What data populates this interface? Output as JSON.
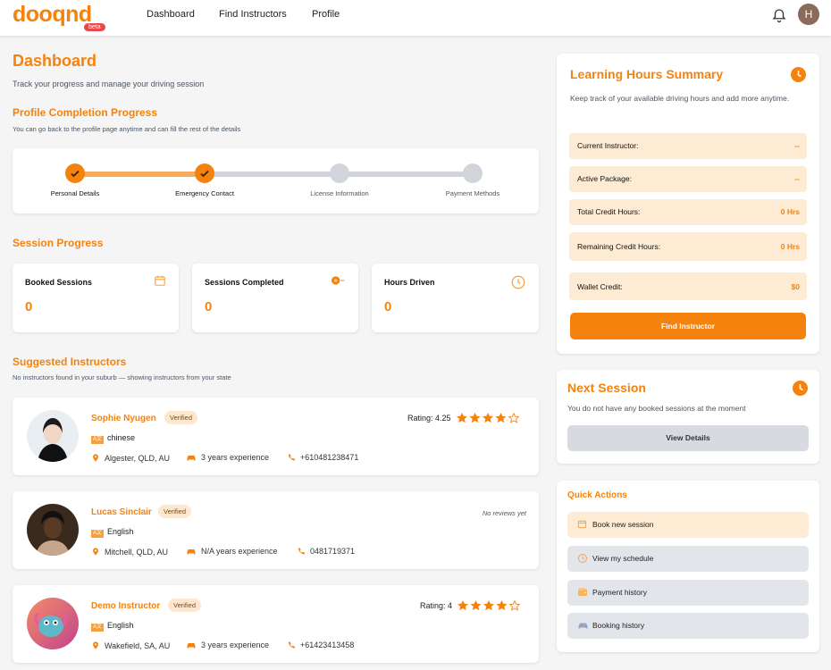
{
  "nav": {
    "logo": "dooqnd",
    "beta": "beta",
    "links": [
      "Dashboard",
      "Find Instructors",
      "Profile"
    ],
    "avatar_letter": "H"
  },
  "dashboard": {
    "title": "Dashboard",
    "subtitle": "Track your progress and manage your driving session"
  },
  "profile_progress": {
    "title": "Profile Completion Progress",
    "subtitle": "You can go back to the profile page anytime and can fill the rest of the details",
    "steps": [
      {
        "label": "Personal Details",
        "done": true
      },
      {
        "label": "Emergency Contact",
        "done": true
      },
      {
        "label": "License Information",
        "done": false
      },
      {
        "label": "Payment Methods",
        "done": false
      }
    ]
  },
  "session_progress": {
    "title": "Session Progress",
    "stats": [
      {
        "label": "Booked Sessions",
        "value": "0",
        "icon": "calendar-icon"
      },
      {
        "label": "Sessions Completed",
        "value": "0",
        "icon": "steering-wheel-icon"
      },
      {
        "label": "Hours Driven",
        "value": "0",
        "icon": "clock-icon"
      }
    ]
  },
  "suggested": {
    "title": "Suggested Instructors",
    "subtitle": "No instructors found in your suburb — showing instructors from your state",
    "instructors": [
      {
        "name": "Sophie Nyugen",
        "badge": "Verified",
        "language": "chinese",
        "location": "Algester, QLD, AU",
        "experience": "3 years experience",
        "phone": "+610481238471",
        "rating_label": "Rating: 4.25",
        "stars": 4
      },
      {
        "name": "Lucas Sinclair",
        "badge": "Verified",
        "language": "English",
        "location": "Mitchell, QLD, AU",
        "experience": "N/A years experience",
        "phone": "0481719371",
        "no_reviews": "No reviews yet"
      },
      {
        "name": "Demo Instructor",
        "badge": "Verified",
        "language": "English",
        "location": "Wakefield, SA, AU",
        "experience": "3 years experience",
        "phone": "+61423413458",
        "rating_label": "Rating: 4",
        "stars": 4
      }
    ]
  },
  "learning_hours": {
    "title": "Learning Hours Summary",
    "description": "Keep track of your available driving hours and add more anytime.",
    "rows": [
      {
        "label": "Current Instructor:",
        "value": "--"
      },
      {
        "label": "Active Package:",
        "value": "--"
      },
      {
        "label": "Total Credit Hours:",
        "value": "0 Hrs"
      },
      {
        "label": "Remaining Credit Hours:",
        "value": "0 Hrs"
      },
      {
        "label": "Wallet Credit:",
        "value": "$0"
      }
    ],
    "button": "Find Instructor"
  },
  "next_session": {
    "title": "Next Session",
    "text": "You do not have any booked sessions at the moment",
    "button": "View Details"
  },
  "quick_actions": {
    "title": "Quick Actions",
    "items": [
      {
        "label": "Book new session",
        "icon": "calendar-icon"
      },
      {
        "label": "View my schedule",
        "icon": "clock-icon"
      },
      {
        "label": "Payment history",
        "icon": "wallet-icon"
      },
      {
        "label": "Booking history",
        "icon": "car-icon"
      }
    ]
  },
  "colors": {
    "accent": "#f5820d",
    "soft": "#fdebd3",
    "grey": "#d7dbe1"
  }
}
